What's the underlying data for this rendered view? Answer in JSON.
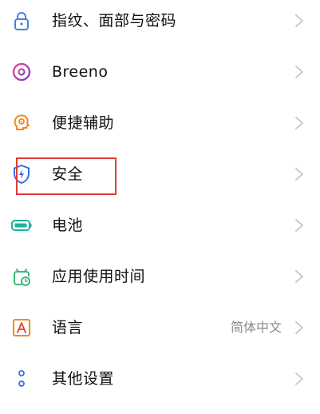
{
  "settings": {
    "items": [
      {
        "label": "指纹、面部与密码",
        "icon": "lock-icon",
        "value": ""
      },
      {
        "label": "Breeno",
        "icon": "breeno-icon",
        "value": ""
      },
      {
        "label": "便捷辅助",
        "icon": "assist-head-icon",
        "value": ""
      },
      {
        "label": "安全",
        "icon": "shield-icon",
        "value": ""
      },
      {
        "label": "电池",
        "icon": "battery-icon",
        "value": ""
      },
      {
        "label": "应用使用时间",
        "icon": "clock-icon",
        "value": ""
      },
      {
        "label": "语言",
        "icon": "language-icon",
        "value": "简体中文"
      },
      {
        "label": "其他设置",
        "icon": "more-dots-icon",
        "value": ""
      }
    ],
    "highlighted_item": "安全"
  },
  "colors": {
    "lock": "#4a7fe0",
    "breeno": "#b33fb8",
    "assist": "#f08a24",
    "shield": "#2f6fe4",
    "battery": "#1db3a0",
    "clock": "#3cb878",
    "language": "#f08a24",
    "more": "#3a6fd8",
    "highlight": "#e03c3c",
    "chevron": "#c4c4c4"
  }
}
